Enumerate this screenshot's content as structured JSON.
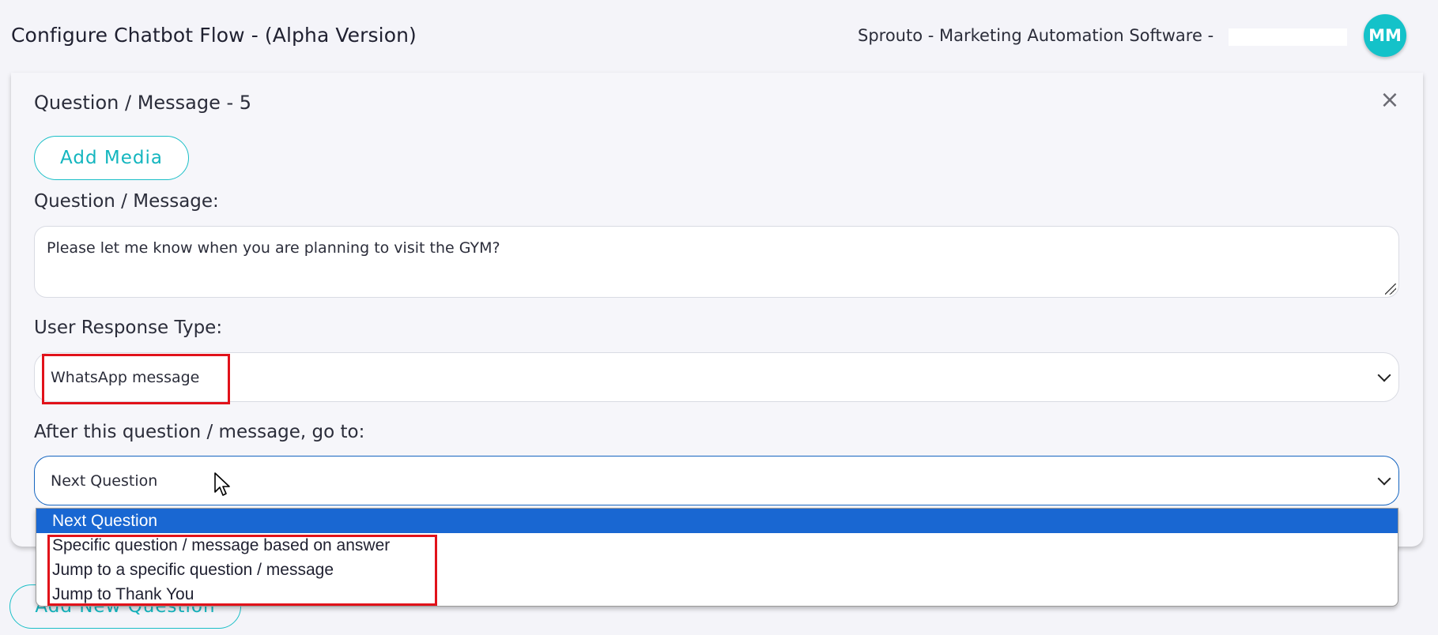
{
  "header": {
    "title": "Configure Chatbot Flow - (Alpha Version)",
    "company": "Sprouto - Marketing Automation Software -",
    "avatar_initials": "MM"
  },
  "card": {
    "title": "Question / Message - 5",
    "close_symbol": "×",
    "add_media_label": "Add Media",
    "message_label": "Question / Message:",
    "message_value": "Please let me know when you are planning to visit the GYM?",
    "response_type_label": "User Response Type:",
    "response_type_value": "WhatsApp message",
    "goto_label": "After this question / message, go to:",
    "goto_value": "Next Question",
    "goto_options": [
      "Next Question",
      "Specific question / message based on answer",
      "Jump to a specific question / message",
      "Jump to Thank You"
    ]
  },
  "footer": {
    "add_question_label": "Add New Question"
  },
  "colors": {
    "accent": "#14b6bf",
    "selection": "#1967d2",
    "highlight": "#e1121a"
  }
}
